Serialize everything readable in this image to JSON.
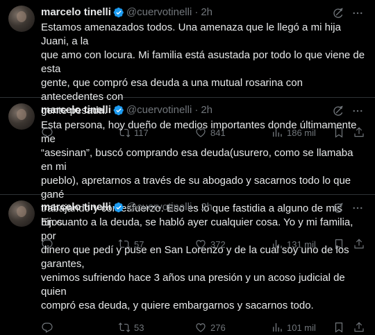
{
  "tweets": [
    {
      "name": "marcelo tinelli",
      "handle": "@cuervotinelli",
      "dot": "·",
      "time": "2h",
      "lines": [
        "Estamos amenazados todos. Una amenaza que le llegó a mi hija Juani, a la",
        "que amo con locura. Mi familia está asustada por todo lo que viene de esta",
        "gente, que compró esa deuda a una mutual rosarina con antecedentes con",
        "gente pesada."
      ],
      "retweets": "117",
      "likes": "841",
      "views": "186 mil"
    },
    {
      "name": "marcelo tinelli",
      "handle": "@cuervotinelli",
      "dot": "·",
      "time": "2h",
      "lines": [
        "Esta persona, hoy dueño de medios importantes donde últimamente me",
        "“asesinan”, buscó comprando esa deuda(usurero, como se llamaba en mi",
        "pueblo), apretarnos a través de su abogado y sacarnos todo lo que gané",
        "trabajando y con esfuerzo. Eso es lo que fastidia a alguno de mis hijos."
      ],
      "retweets": "57",
      "likes": "372",
      "views": "131 mil"
    },
    {
      "name": "marcelo tinelli",
      "handle": "@cuervotinelli",
      "dot": "·",
      "time": "2h",
      "lines": [
        "En cuanto a la deuda, se habló ayer cualquier cosa. Yo y mi familia, por",
        "dinero que pedí y puse en San Lorenzo y de la cual soy uno de los garantes,",
        "venimos sufriendo hace 3 años una presión y un acoso judicial de quien",
        "compró esa deuda, y quiere embargarnos y sacarnos todo."
      ],
      "retweets": "53",
      "likes": "276",
      "views": "101 mil"
    }
  ],
  "colors": {
    "background": "#000000",
    "text": "#e7e9ea",
    "muted": "#71767b",
    "verified": "#1d9bf0",
    "divider": "#2f3336"
  }
}
